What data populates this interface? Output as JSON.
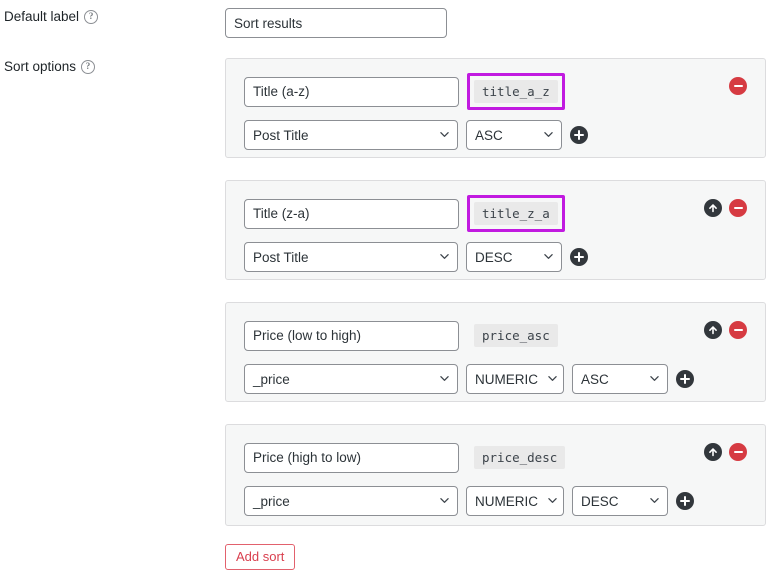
{
  "form": {
    "default_label": {
      "label": "Default label",
      "help_icon": "question-mark-circle-icon",
      "value": "Sort results",
      "placeholder": ""
    },
    "sort_options": {
      "label": "Sort options",
      "help_icon": "question-mark-circle-icon"
    },
    "add_sort_button": "Add sort"
  },
  "icons": {
    "remove": "remove-circle-icon",
    "move_up": "arrow-up-circle-icon",
    "add": "plus-circle-icon",
    "chevron": "chevron-down-icon"
  },
  "colors": {
    "highlight": "#c11ae0",
    "remove_red": "#d63b42",
    "dark_icon": "#32373c",
    "panel_bg": "#f6f7f7",
    "panel_border": "#dcdcde",
    "badge_bg": "#e9e9e9",
    "add_button_text": "#d9404f",
    "add_button_border": "#e2616d"
  },
  "sorts": [
    {
      "label": "Title (a-z)",
      "slug": "title_a_z",
      "slug_highlighted": true,
      "orderby": "Post Title",
      "has_type_select": false,
      "type": "",
      "order": "ASC",
      "has_move_up": false,
      "has_remove": true
    },
    {
      "label": "Title (z-a)",
      "slug": "title_z_a",
      "slug_highlighted": true,
      "orderby": "Post Title",
      "has_type_select": false,
      "type": "",
      "order": "DESC",
      "has_move_up": true,
      "has_remove": true
    },
    {
      "label": "Price (low to high)",
      "slug": "price_asc",
      "slug_highlighted": false,
      "orderby": "_price",
      "has_type_select": true,
      "type": "NUMERIC",
      "order": "ASC",
      "has_move_up": true,
      "has_remove": true
    },
    {
      "label": "Price (high to low)",
      "slug": "price_desc",
      "slug_highlighted": false,
      "orderby": "_price",
      "has_type_select": true,
      "type": "NUMERIC",
      "order": "DESC",
      "has_move_up": true,
      "has_remove": true
    }
  ]
}
